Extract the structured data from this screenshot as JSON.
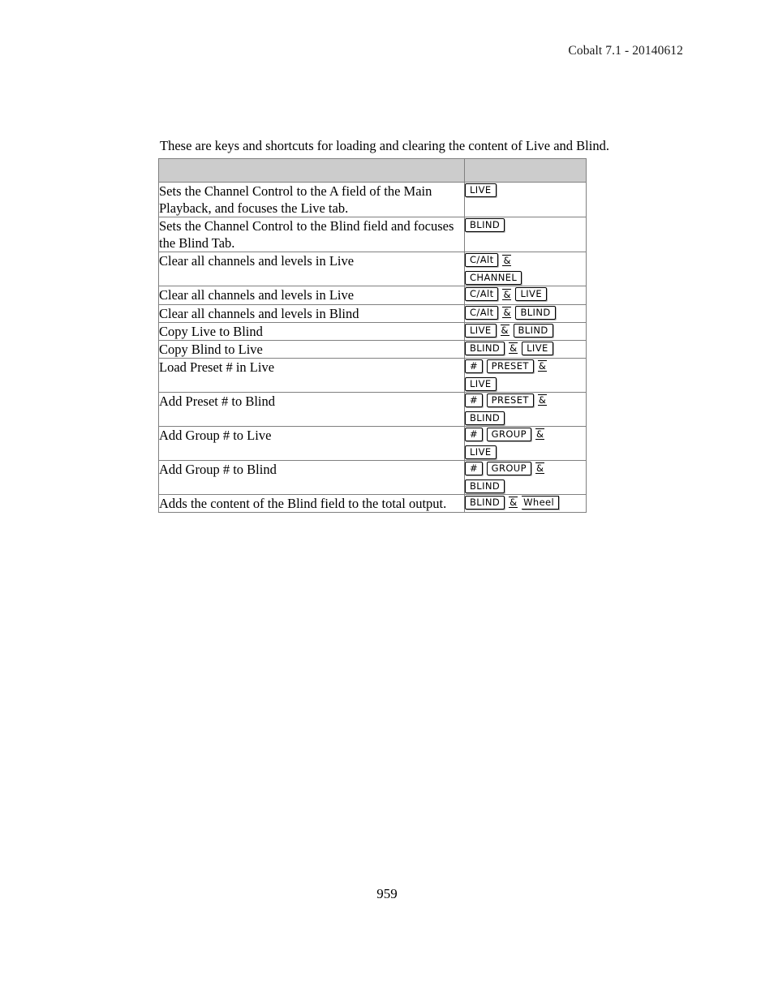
{
  "document": {
    "header": "Cobalt 7.1 - 20140612",
    "page_number": "959",
    "intro": "These are keys and shortcuts for loading and clearing the content of Live and Blind."
  },
  "table": {
    "header": {
      "description_label": "",
      "keys_label": ""
    },
    "rows": [
      {
        "description": "Sets the Channel Control to the A field of the Main Playback, and focuses the Live tab.",
        "keys": [
          [
            {
              "type": "key",
              "label": "LIVE"
            }
          ]
        ]
      },
      {
        "description": "Sets the Channel Control to the Blind field and focuses the Blind Tab.",
        "keys": [
          [
            {
              "type": "key",
              "label": "BLIND"
            }
          ]
        ]
      },
      {
        "description": "Clear all channels and levels in Live",
        "keys": [
          [
            {
              "type": "key",
              "label": "C/Alt"
            },
            {
              "type": "amp",
              "label": "&"
            }
          ],
          [
            {
              "type": "key",
              "label": "CHANNEL"
            }
          ]
        ]
      },
      {
        "description": "Clear all channels and levels in Live",
        "keys": [
          [
            {
              "type": "key",
              "label": "C/Alt"
            },
            {
              "type": "amp",
              "label": "&"
            },
            {
              "type": "key",
              "label": "LIVE"
            }
          ]
        ]
      },
      {
        "description": "Clear all channels and levels in Blind",
        "keys": [
          [
            {
              "type": "key",
              "label": "C/Alt"
            },
            {
              "type": "amp",
              "label": "&"
            },
            {
              "type": "key",
              "label": "BLIND"
            }
          ]
        ]
      },
      {
        "description": "Copy Live to Blind",
        "keys": [
          [
            {
              "type": "key",
              "label": "LIVE"
            },
            {
              "type": "amp",
              "label": "&"
            },
            {
              "type": "key",
              "label": "BLIND"
            }
          ]
        ]
      },
      {
        "description": "Copy Blind to Live",
        "keys": [
          [
            {
              "type": "key",
              "label": "BLIND"
            },
            {
              "type": "amp",
              "label": "&"
            },
            {
              "type": "key",
              "label": "LIVE"
            }
          ]
        ]
      },
      {
        "description": "Load Preset # in Live",
        "keys": [
          [
            {
              "type": "key",
              "label": "#"
            },
            {
              "type": "gap"
            },
            {
              "type": "key",
              "label": "PRESET"
            },
            {
              "type": "amp",
              "label": "&"
            }
          ],
          [
            {
              "type": "key",
              "label": "LIVE"
            }
          ]
        ]
      },
      {
        "description": "Add Preset # to Blind",
        "keys": [
          [
            {
              "type": "key",
              "label": "#"
            },
            {
              "type": "gap"
            },
            {
              "type": "key",
              "label": "PRESET"
            },
            {
              "type": "amp",
              "label": "&"
            }
          ],
          [
            {
              "type": "key",
              "label": "BLIND"
            }
          ]
        ]
      },
      {
        "description": "Add Group # to Live",
        "keys": [
          [
            {
              "type": "key",
              "label": "#"
            },
            {
              "type": "gap"
            },
            {
              "type": "key",
              "label": "GROUP"
            },
            {
              "type": "amp",
              "label": "&"
            }
          ],
          [
            {
              "type": "key",
              "label": "LIVE"
            }
          ]
        ]
      },
      {
        "description": "Add Group # to Blind",
        "keys": [
          [
            {
              "type": "key",
              "label": "#"
            },
            {
              "type": "gap"
            },
            {
              "type": "key",
              "label": "GROUP"
            },
            {
              "type": "amp",
              "label": "&"
            }
          ],
          [
            {
              "type": "key",
              "label": "BLIND"
            }
          ]
        ]
      },
      {
        "description": "Adds the content of the Blind field to the total output.",
        "keys": [
          [
            {
              "type": "key",
              "label": "BLIND"
            },
            {
              "type": "amp",
              "label": "&"
            },
            {
              "type": "key",
              "label": "Wheel",
              "style": "open"
            }
          ]
        ]
      }
    ]
  },
  "colors": {
    "header_row_background": "#cccccc",
    "table_border": "#808080",
    "keycap_border": "#000000",
    "keycap_shadow": "#b4b4b4",
    "text": "#000000"
  }
}
